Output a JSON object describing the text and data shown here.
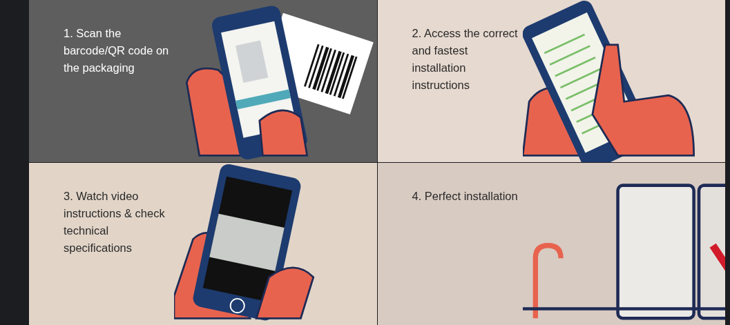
{
  "panels": [
    {
      "kind": "scan",
      "caption": "1. Scan the barcode/QR code on the packaging",
      "color": "#5e5e5e"
    },
    {
      "kind": "list",
      "caption": "2. Access the correct and fastest installation instructions",
      "color": "#e6d9cf"
    },
    {
      "kind": "video",
      "caption": "3. Watch video instructions & check technical specifications",
      "color": "#e2d5c8"
    },
    {
      "kind": "install",
      "caption": "4. Perfect installation",
      "color": "#d8cbc2"
    }
  ]
}
